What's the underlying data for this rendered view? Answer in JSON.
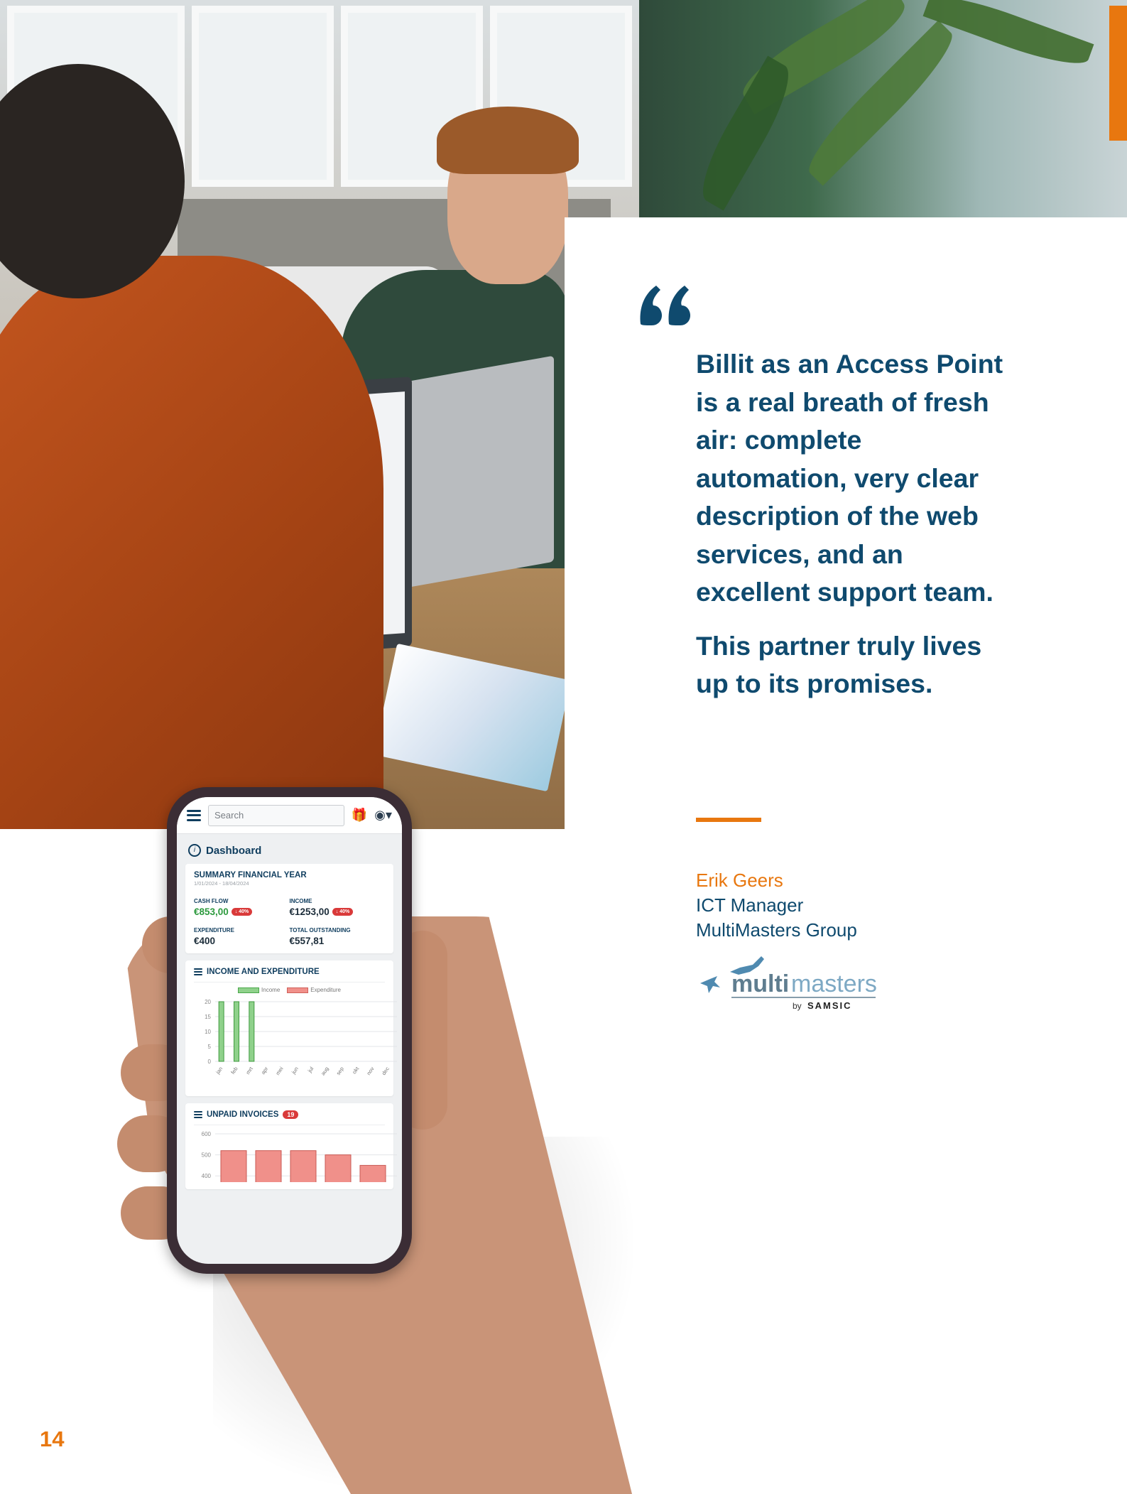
{
  "phone": {
    "search_placeholder": "Search",
    "dashboard_title": "Dashboard",
    "summary": {
      "title": "SUMMARY FINANCIAL YEAR",
      "period": "1/01/2024 - 18/04/2024",
      "cash_flow_label": "CASH FLOW",
      "cash_flow_value": "€853,00",
      "cash_flow_change": "↓ 40%",
      "income_label": "INCOME",
      "income_value": "€1253,00",
      "income_change": "↓ 40%",
      "expenditure_label": "EXPENDITURE",
      "expenditure_value": "€400",
      "outstanding_label": "TOTAL OUTSTANDING",
      "outstanding_value": "€557,81"
    },
    "income_expenditure_title": "INCOME AND EXPENDITURE",
    "unpaid_title": "UNPAID INVOICES",
    "unpaid_count": "19"
  },
  "chart_data": [
    {
      "type": "bar",
      "title": "INCOME AND EXPENDITURE",
      "categories": [
        "jan",
        "feb",
        "mrt",
        "apr",
        "mei",
        "jun",
        "jul",
        "aug",
        "sep",
        "okt",
        "nov",
        "dec"
      ],
      "series": [
        {
          "name": "Income",
          "values": [
            20,
            20,
            20,
            0,
            0,
            0,
            0,
            0,
            0,
            0,
            0,
            0
          ],
          "color": "#8fd18b"
        },
        {
          "name": "Expenditure",
          "values": [
            0,
            0,
            0,
            0,
            0,
            0,
            0,
            0,
            0,
            0,
            0,
            0
          ],
          "color": "#f0908a"
        }
      ],
      "yticks": [
        "0",
        "5",
        "10",
        "15",
        "20"
      ],
      "ylim": [
        0,
        20
      ],
      "legend": "top-center",
      "grid": true
    },
    {
      "type": "bar",
      "title": "UNPAID INVOICES",
      "values": [
        520,
        520,
        520,
        500,
        450
      ],
      "yticks": [
        "400",
        "500",
        "600"
      ],
      "ylim": [
        350,
        600
      ],
      "color": "#f0908a",
      "grid": true
    }
  ],
  "quote": {
    "paragraph1": "Billit as an Access Point is a real breath of fresh air: complete automation, very clear description of the web services, and an excellent support team.",
    "paragraph2": "This partner truly lives up to its promises."
  },
  "signature": {
    "name": "Erik Geers",
    "role": "ICT Manager",
    "company": "MultiMasters Group"
  },
  "logo": {
    "part1": "multi",
    "part2": "masters",
    "by": "by",
    "brand": "SAMSIC"
  },
  "page_number": "14",
  "colors": {
    "navy": "#0f4a6e",
    "orange": "#e8770f"
  }
}
